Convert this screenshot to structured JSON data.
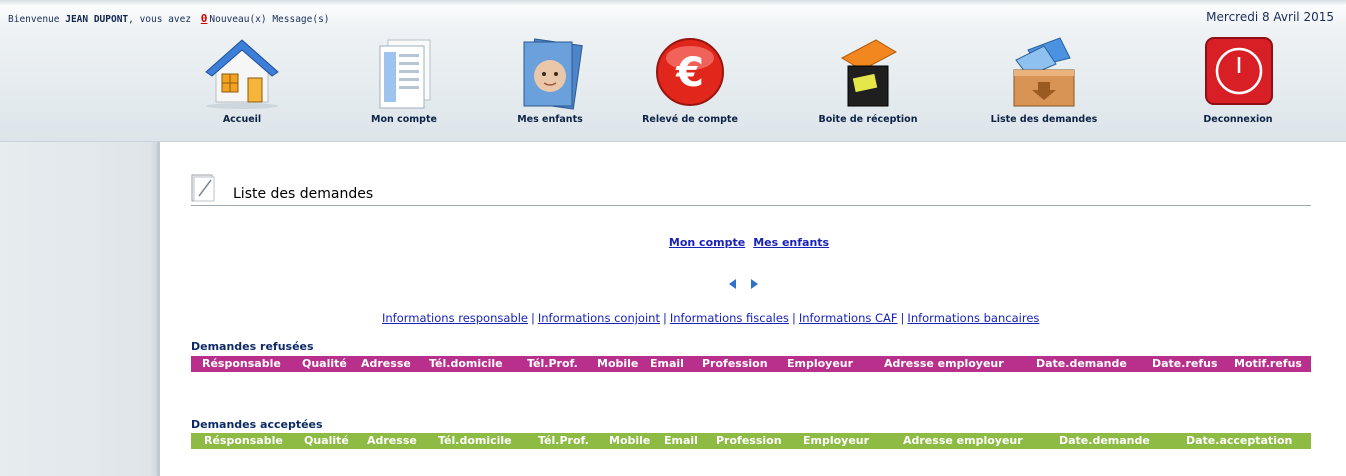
{
  "header": {
    "welcome_prefix": "Bienvenue",
    "user_name": "JEAN DUPONT",
    "welcome_middle": ", vous avez",
    "message_count": "0",
    "message_suffix": "Nouveau(x) Message(s)",
    "date": "Mercredi 8 Avril 2015"
  },
  "nav": {
    "items": [
      {
        "label": "Accueil",
        "icon": "house-icon"
      },
      {
        "label": "Mon compte",
        "icon": "documents-icon"
      },
      {
        "label": "Mes enfants",
        "icon": "child-photo-icon"
      },
      {
        "label": "Relevé de compte",
        "icon": "euro-icon"
      },
      {
        "label": "Boite de réception",
        "icon": "inbox-icon"
      },
      {
        "label": "Liste des demandes",
        "icon": "box-icon"
      },
      {
        "label": "Deconnexion",
        "icon": "power-icon"
      }
    ]
  },
  "page": {
    "title": "Liste des demandes",
    "links": [
      "Mon compte",
      "Mes enfants"
    ],
    "info_links": [
      "Informations responsable",
      "Informations conjoint",
      "Informations fiscales",
      "Informations CAF",
      "Informations bancaires"
    ],
    "info_separator": "|"
  },
  "refused": {
    "title": "Demandes refusées",
    "color": "#b82f8c",
    "columns": [
      "Résponsable",
      "Qualité",
      "Adresse",
      "Tél.domicile",
      "Tél.Prof.",
      "Mobile",
      "Email",
      "Profession",
      "Employeur",
      "Adresse employeur",
      "Date.demande",
      "Date.refus",
      "Motif.refus"
    ]
  },
  "accepted": {
    "title": "Demandes acceptées",
    "color": "#8dbb43",
    "columns": [
      "Résponsable",
      "Qualité",
      "Adresse",
      "Tél.domicile",
      "Tél.Prof.",
      "Mobile",
      "Email",
      "Profession",
      "Employeur",
      "Adresse employeur",
      "Date.demande",
      "Date.acceptation"
    ]
  }
}
